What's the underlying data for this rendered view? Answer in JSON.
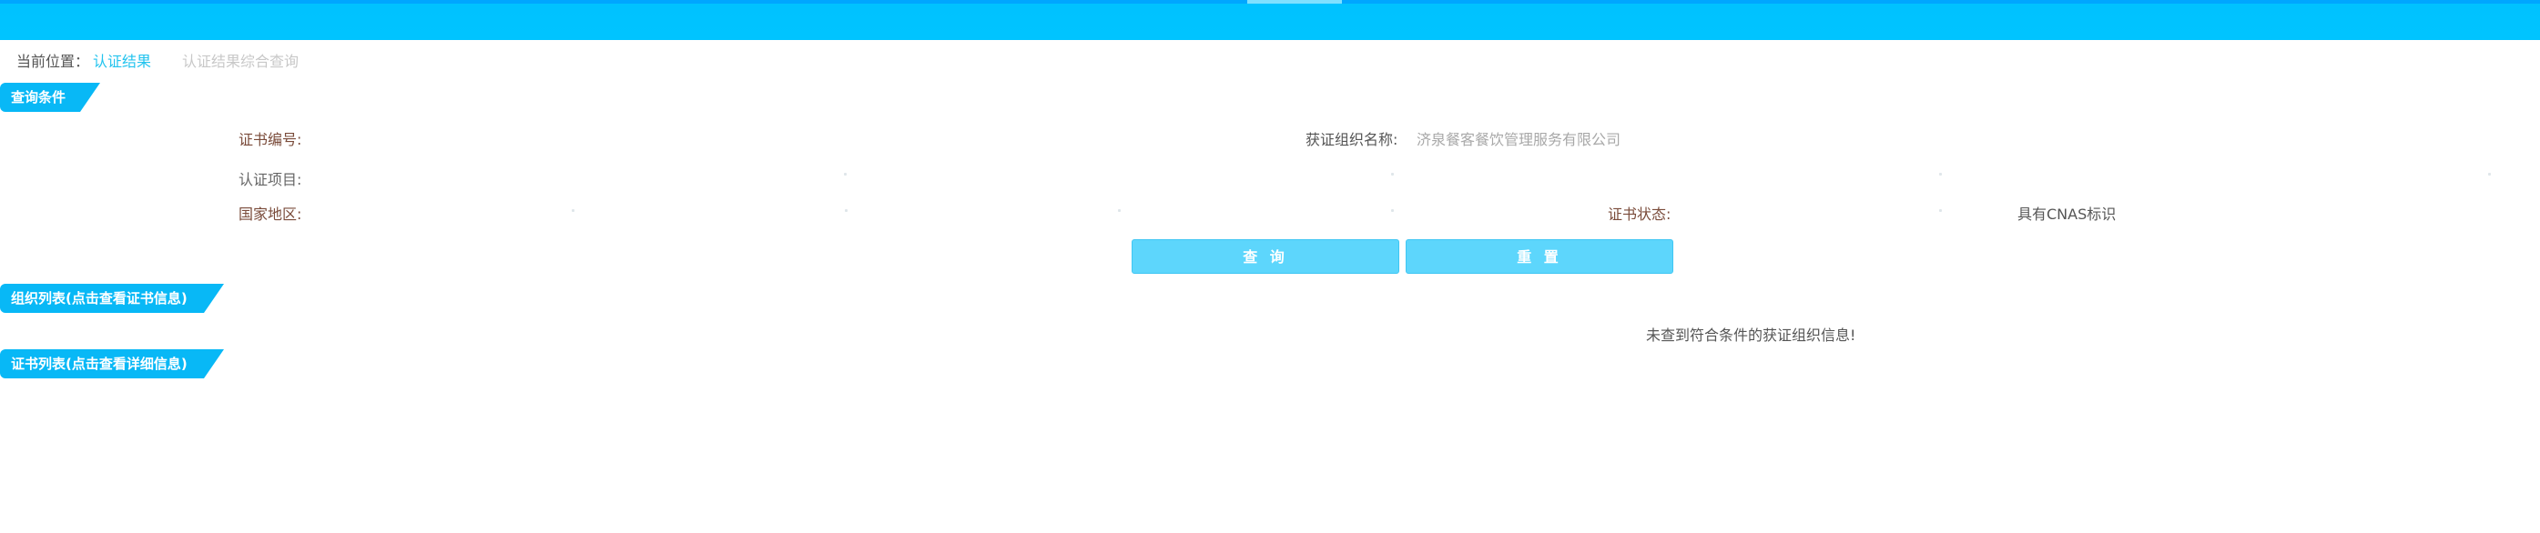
{
  "breadcrumb": {
    "label": "当前位置：",
    "link": "认证结果",
    "current": "认证结果综合查询"
  },
  "sections": {
    "query": "查询条件",
    "org_list": "组织列表(点击查看证书信息)",
    "cert_list": "证书列表(点击查看详细信息)"
  },
  "form": {
    "cert_no_label": "证书编号:",
    "org_name_label": "获证组织名称:",
    "org_name_value": "济泉餐客餐饮管理服务有限公司",
    "project_label": "认证项目:",
    "region_label": "国家地区:",
    "cert_status_label": "证书状态:",
    "cnas_label": "具有CNAS标识"
  },
  "buttons": {
    "query": "查 询",
    "reset": "重 置"
  },
  "org_list": {
    "empty_message": "未查到符合条件的获证组织信息!"
  },
  "colors": {
    "topbar": "#00c2ff",
    "accent": "#08b8f6",
    "button": "#5dd6fc",
    "link": "#22c3ee"
  }
}
